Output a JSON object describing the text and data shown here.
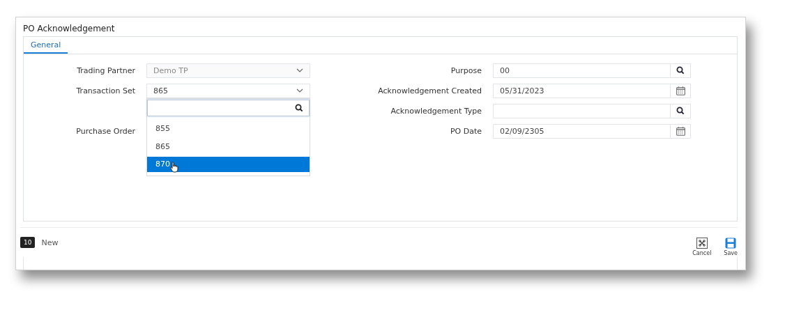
{
  "window": {
    "title": "PO Acknowledgement"
  },
  "tabs": [
    {
      "label": "General",
      "selected": true
    }
  ],
  "left_fields": [
    {
      "label": "Trading Partner",
      "kind": "dropdown",
      "value": "Demo TP",
      "disabled": true,
      "expanded": false
    },
    {
      "label": "Transaction Set",
      "kind": "dropdown",
      "value": "865",
      "disabled": false,
      "expanded": true
    },
    {
      "kind": "blank"
    },
    {
      "label": "Purchase Order",
      "kind": "covered"
    }
  ],
  "dropdown_options": [
    {
      "label": "855",
      "selected": false
    },
    {
      "label": "865",
      "selected": false
    },
    {
      "label": "870",
      "selected": true
    }
  ],
  "right_fields": [
    {
      "label": "Purpose",
      "kind": "lookup",
      "value": "00"
    },
    {
      "label": "Acknowledgement Created",
      "kind": "date",
      "value": "05/31/2023"
    },
    {
      "label": "Acknowledgement Type",
      "kind": "lookup"
    },
    {
      "label": "PO Date",
      "kind": "date",
      "value": "02/09/2305"
    }
  ],
  "footer": {
    "badge": "10",
    "status": "New"
  },
  "actions": [
    {
      "label": "Cancel",
      "kind": "cancel"
    },
    {
      "label": "Save",
      "kind": "save"
    }
  ]
}
